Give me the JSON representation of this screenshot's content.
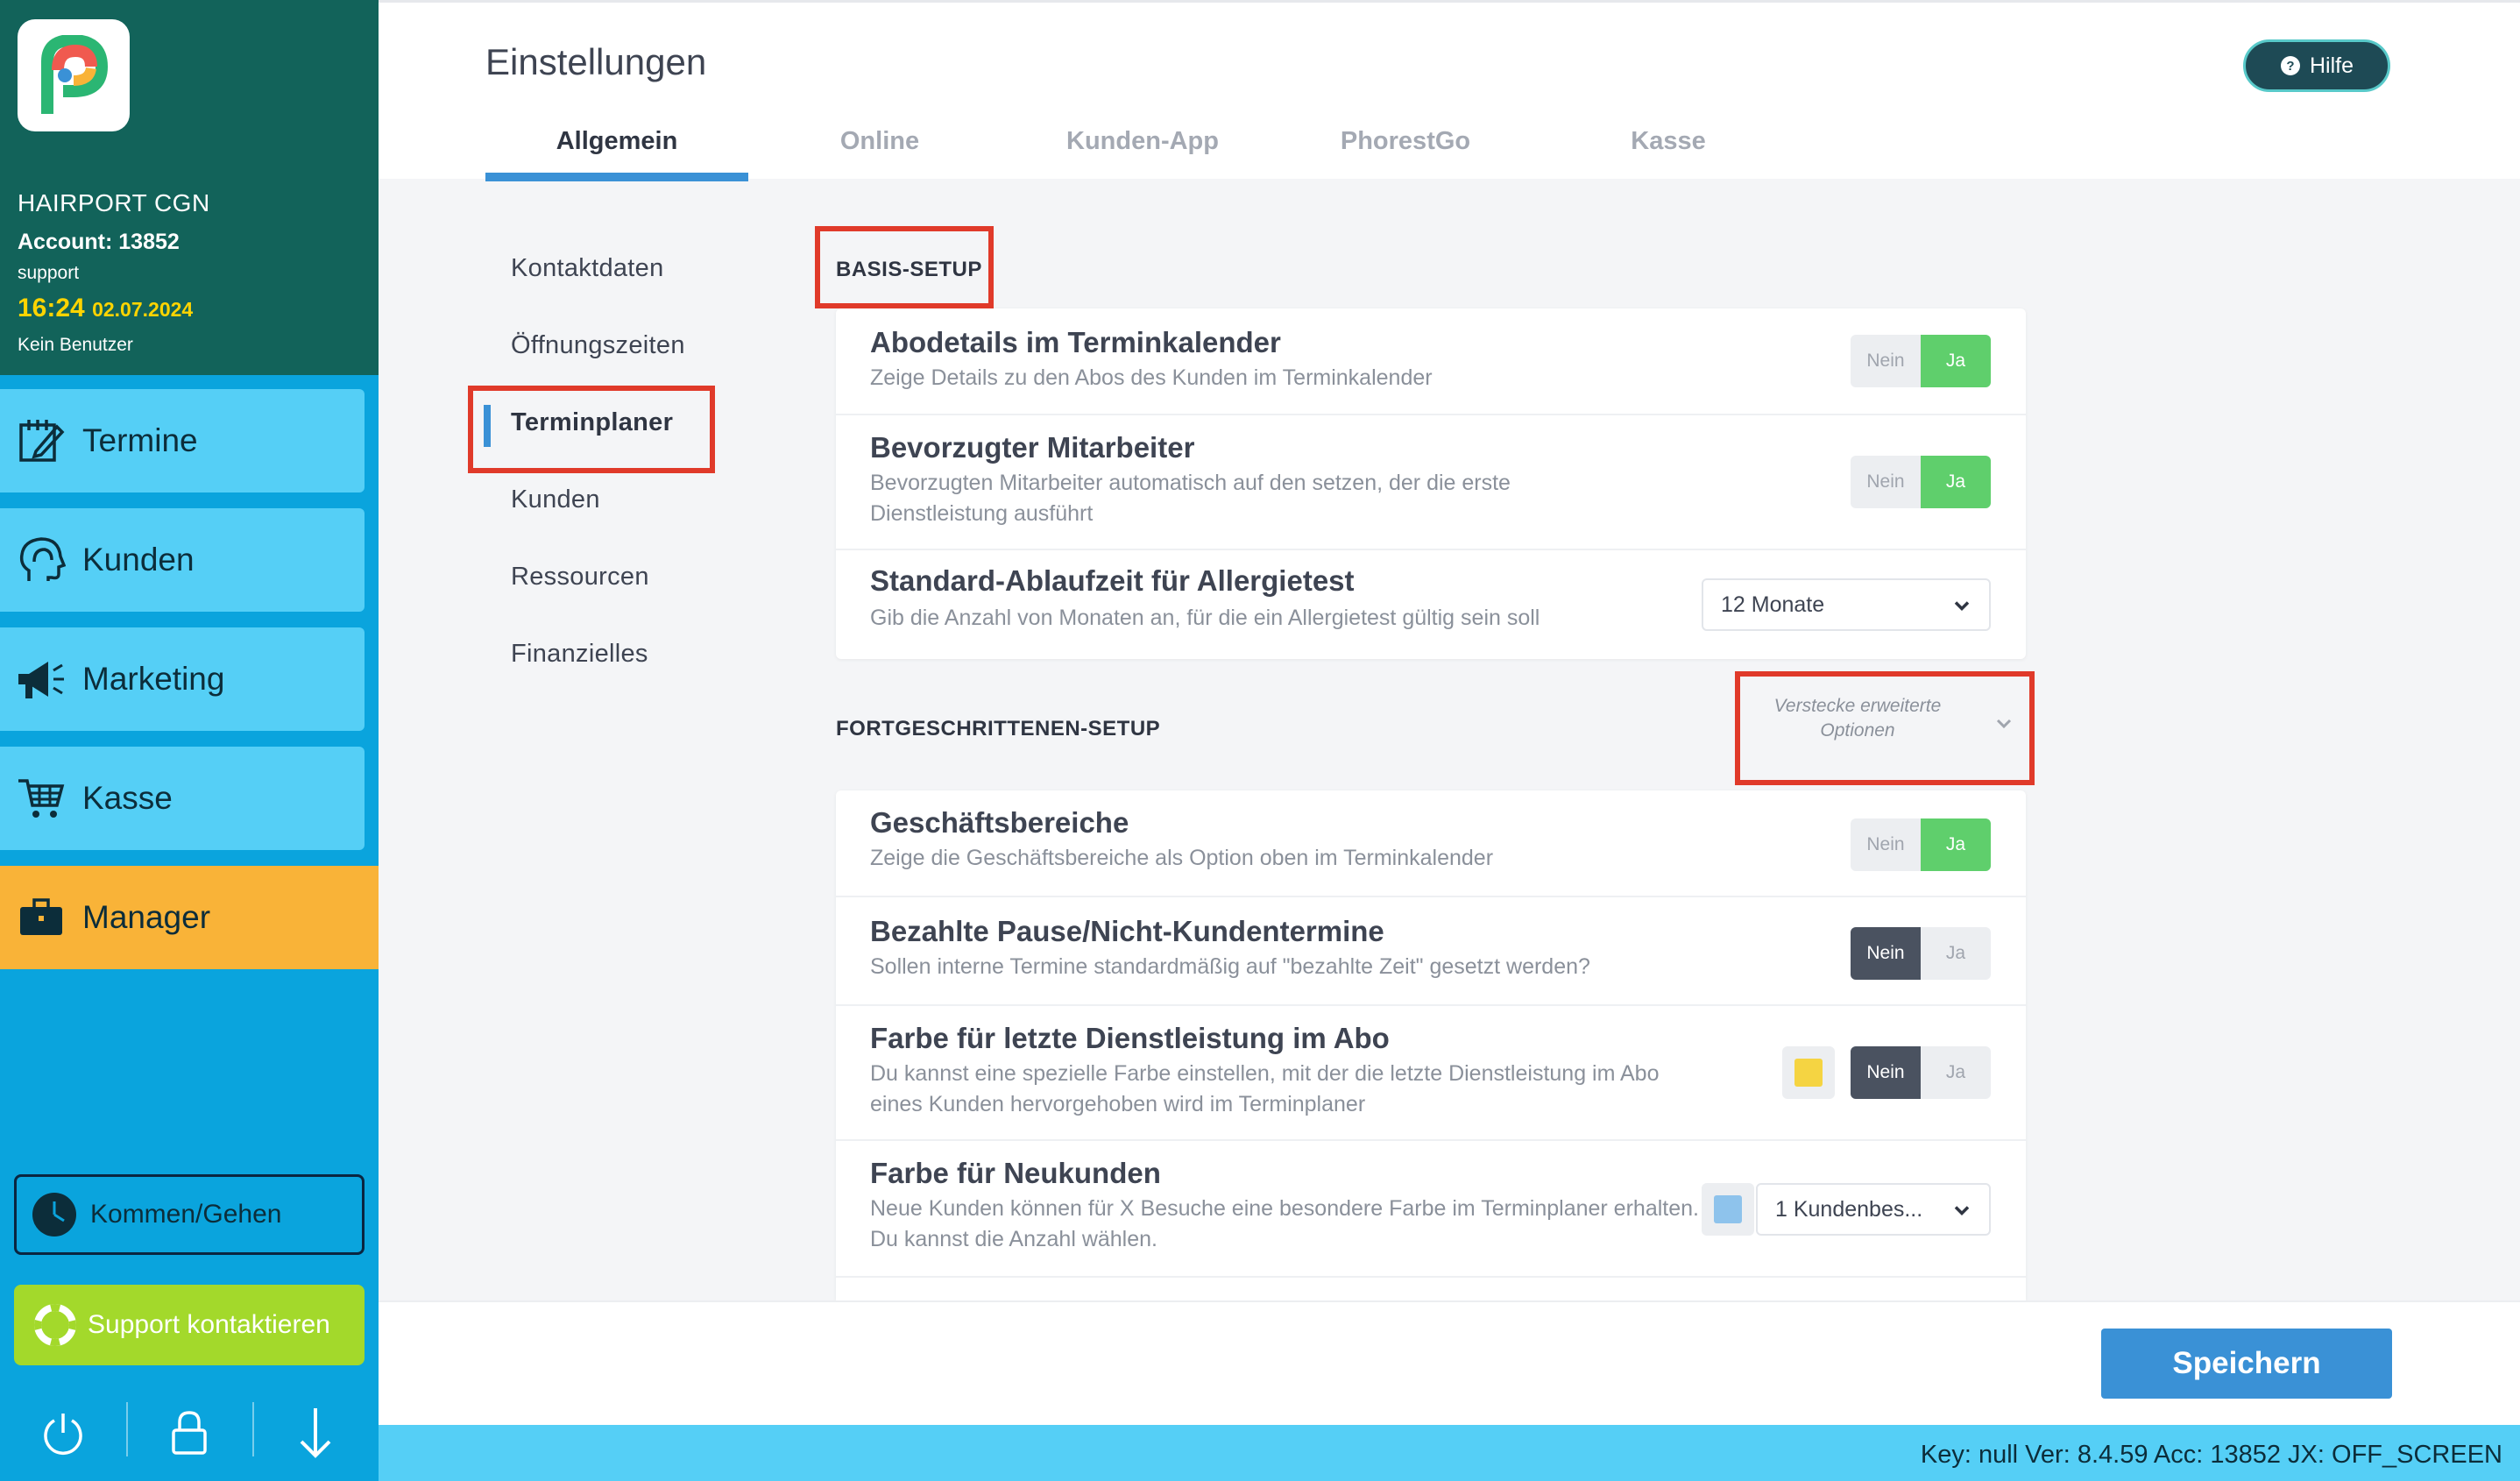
{
  "sidebar": {
    "salon_name": "HAIRPORT CGN",
    "account": "Account: 13852",
    "user": "support",
    "time": "16:24",
    "date": "02.07.2024",
    "no_user": "Kein Benutzer",
    "nav": [
      {
        "label": "Termine",
        "icon": "calendar-edit-icon"
      },
      {
        "label": "Kunden",
        "icon": "customer-head-icon"
      },
      {
        "label": "Marketing",
        "icon": "megaphone-icon"
      },
      {
        "label": "Kasse",
        "icon": "cart-icon"
      },
      {
        "label": "Manager",
        "icon": "briefcase-icon"
      }
    ],
    "kommen_gehen": "Kommen/Gehen",
    "support": "Support kontaktieren",
    "bottom_icons": [
      "power-icon",
      "lock-icon",
      "arrow-down-icon"
    ]
  },
  "header": {
    "title": "Einstellungen",
    "help": "Hilfe",
    "tabs": [
      "Allgemein",
      "Online",
      "Kunden-App",
      "PhorestGo",
      "Kasse"
    ],
    "active_tab": "Allgemein"
  },
  "submenu": {
    "items": [
      "Kontaktdaten",
      "Öffnungszeiten",
      "Terminplaner",
      "Kunden",
      "Ressourcen",
      "Finanzielles"
    ],
    "active": "Terminplaner"
  },
  "basis": {
    "title": "BASIS-SETUP",
    "rows": [
      {
        "title": "Abodetails im Terminkalender",
        "desc": "Zeige Details zu den Abos des Kunden im Terminkalender",
        "value": "Ja"
      },
      {
        "title": "Bevorzugter Mitarbeiter",
        "desc": "Bevorzugten Mitarbeiter automatisch auf den setzen, der die erste Dienstleistung ausführt",
        "value": "Ja"
      },
      {
        "title": "Standard-Ablaufzeit für Allergietest",
        "desc": "Gib die Anzahl von Monaten an, für die ein Allergietest gültig sein soll",
        "select": "12 Monate"
      }
    ]
  },
  "advanced": {
    "title": "FORTGESCHRITTENEN-SETUP",
    "toggle_label": "Verstecke erweiterte Optionen",
    "rows": [
      {
        "title": "Geschäftsbereiche",
        "desc": "Zeige die Geschäftsbereiche als Option oben im Terminkalender",
        "value": "Ja"
      },
      {
        "title": "Bezahlte Pause/Nicht-Kundentermine",
        "desc": "Sollen interne Termine standardmäßig auf \"bezahlte Zeit\" gesetzt werden?",
        "value": "Nein"
      },
      {
        "title": "Farbe für letzte Dienstleistung im Abo",
        "desc": "Du kannst eine spezielle Farbe einstellen, mit der die letzte Dienstleistung im Abo eines Kunden hervorgehoben wird im Terminplaner",
        "value": "Nein",
        "swatch": "#f5d442"
      },
      {
        "title": "Farbe für Neukunden",
        "desc": "Neue Kunden können für X Besuche eine besondere Farbe im Terminplaner erhalten. Du kannst die Anzahl wählen.",
        "select": "1 Kundenbes...",
        "swatch": "#8ec3ec"
      }
    ]
  },
  "toggle_labels": {
    "no": "Nein",
    "yes": "Ja"
  },
  "footer": {
    "save": "Speichern",
    "status": "Key: null Ver: 8.4.59 Acc: 13852  JX: OFF_SCREEN"
  },
  "colors": {
    "sidebar_header": "#12635a",
    "sidebar": "#0aa4dd",
    "nav": "#55cff6",
    "manager": "#f9b338",
    "accent": "#3a91d6",
    "toggle_on": "#5fcf6c",
    "highlight": "#e03a2a"
  }
}
